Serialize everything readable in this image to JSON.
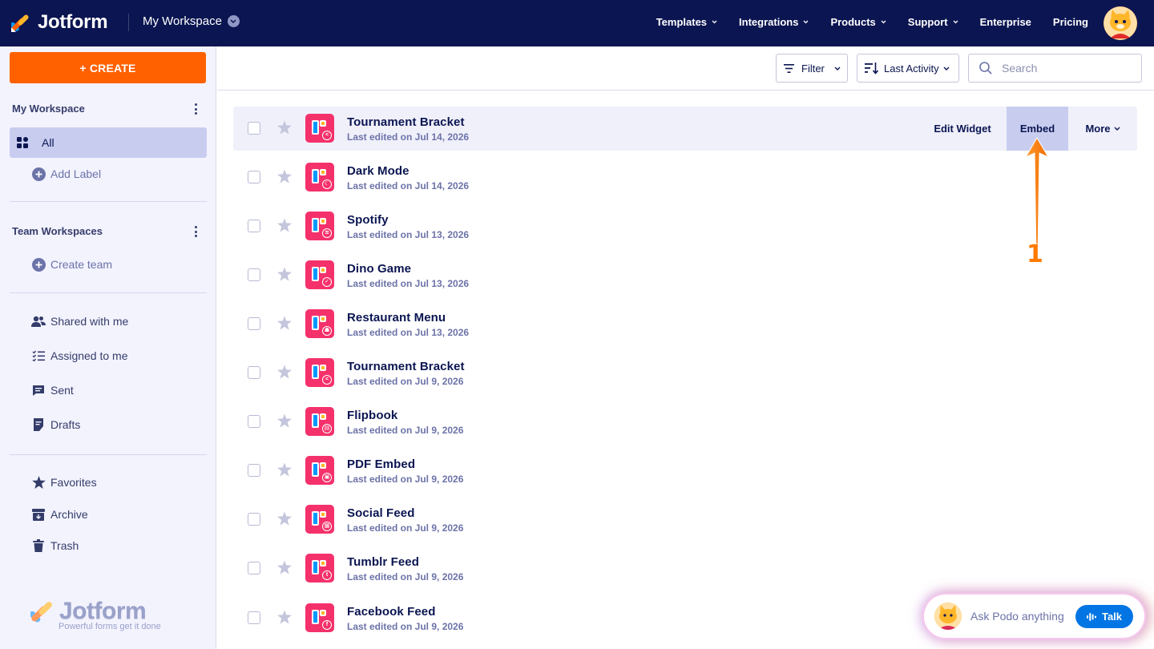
{
  "brand": {
    "name": "Jotform",
    "tagline": "Powerful forms get it done"
  },
  "header": {
    "workspace_label": "My Workspace",
    "nav": [
      "Templates",
      "Integrations",
      "Products",
      "Support",
      "Enterprise",
      "Pricing"
    ],
    "nav_has_dropdown": [
      true,
      true,
      true,
      true,
      false,
      false
    ]
  },
  "sidebar": {
    "create_label": "+ CREATE",
    "my_workspace_title": "My Workspace",
    "all_label": "All",
    "add_label": "Add Label",
    "team_workspaces_title": "Team Workspaces",
    "create_team_label": "Create team",
    "shared_label": "Shared with me",
    "assigned_label": "Assigned to me",
    "sent_label": "Sent",
    "drafts_label": "Drafts",
    "favorites_label": "Favorites",
    "archive_label": "Archive",
    "trash_label": "Trash"
  },
  "toolbar": {
    "filter_label": "Filter",
    "sort_label": "Last Activity",
    "search_placeholder": "Search"
  },
  "row_actions": {
    "edit": "Edit Widget",
    "embed": "Embed",
    "more": "More"
  },
  "items": [
    {
      "title": "Tournament Bracket",
      "edited": "Last edited on Jul 14, 2026",
      "badge": "<"
    },
    {
      "title": "Dark Mode",
      "edited": "Last edited on Jul 14, 2026",
      "badge": "☾"
    },
    {
      "title": "Spotify",
      "edited": "Last edited on Jul 13, 2026",
      "badge": "≋"
    },
    {
      "title": "Dino Game",
      "edited": "Last edited on Jul 13, 2026",
      "badge": "✓"
    },
    {
      "title": "Restaurant Menu",
      "edited": "Last edited on Jul 13, 2026",
      "badge": "☗"
    },
    {
      "title": "Tournament Bracket",
      "edited": "Last edited on Jul 9, 2026",
      "badge": "<"
    },
    {
      "title": "Flipbook",
      "edited": "Last edited on Jul 9, 2026",
      "badge": "▤"
    },
    {
      "title": "PDF Embed",
      "edited": "Last edited on Jul 9, 2026",
      "badge": "▣"
    },
    {
      "title": "Social Feed",
      "edited": "Last edited on Jul 9, 2026",
      "badge": "▦"
    },
    {
      "title": "Tumblr Feed",
      "edited": "Last edited on Jul 9, 2026",
      "badge": "t"
    },
    {
      "title": "Facebook Feed",
      "edited": "Last edited on Jul 9, 2026",
      "badge": "f"
    }
  ],
  "annotation": {
    "step": "1"
  },
  "assistant": {
    "prompt": "Ask Podo anything",
    "talk_label": "Talk"
  },
  "colors": {
    "navy": "#0a1551",
    "orange": "#ff6100",
    "app_pink": "#f5316b",
    "active_bg": "#c8cdf0",
    "sidebar_bg": "#f3f3fe",
    "talk_blue": "#0075e3"
  }
}
